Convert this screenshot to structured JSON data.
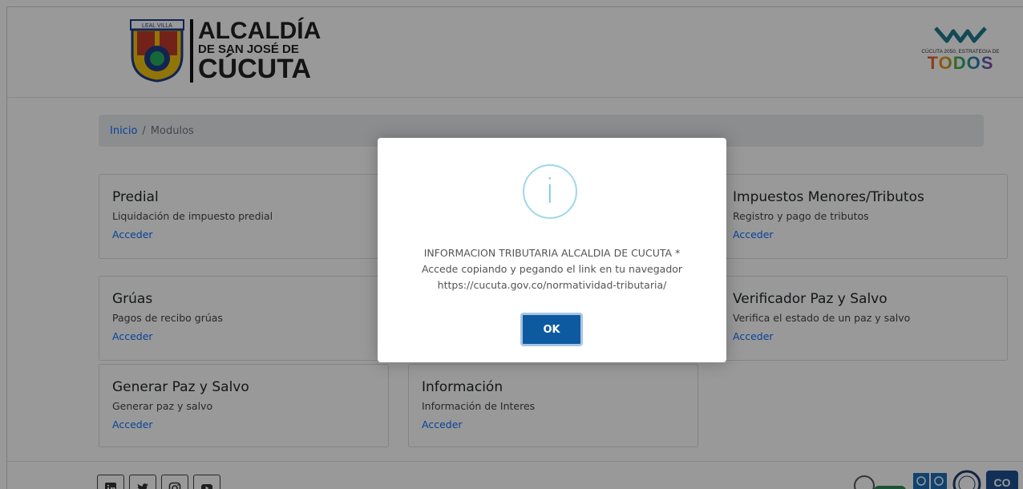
{
  "header": {
    "logo": {
      "line1": "ALCALDÍA",
      "line2": "DE SAN JOSÉ DE",
      "line3": "CÚCUTA"
    },
    "right_logo": {
      "caption": "CÚCUTA 2050, ESTRATEGIA DE",
      "word": "TODOS"
    }
  },
  "breadcrumb": {
    "home": "Inicio",
    "separator": "/",
    "current": "Modulos"
  },
  "modules": [
    {
      "title": "Predial",
      "desc": "Liquidación de impuesto predial",
      "link": "Acceder"
    },
    {
      "title": "Impuestos Menores/Tributos",
      "desc": "Registro y pago de tributos",
      "link": "Acceder"
    },
    {
      "title": "Grúas",
      "desc": "Pagos de recibo grúas",
      "link": "Acceder"
    },
    {
      "title": "Verificador Paz y Salvo",
      "desc": "Verifica el estado de un paz y salvo",
      "link": "Acceder"
    },
    {
      "title": "Generar Paz y Salvo",
      "desc": "Generar paz y salvo",
      "link": "Acceder"
    },
    {
      "title": "Información",
      "desc": "Información de Interes",
      "link": "Acceder"
    }
  ],
  "footer": {
    "social_icons": [
      "linkedin-icon",
      "twitter-icon",
      "instagram-icon",
      "youtube-icon"
    ],
    "badge_text": "CO"
  },
  "modal": {
    "icon": "i",
    "line1": "INFORMACION TRIBUTARIA ALCALDIA DE CUCUTA *",
    "line2": "Accede copiando y pegando el link en tu navegador",
    "line3": "https://cucuta.gov.co/normatividad-tributaria/",
    "ok_label": "OK"
  },
  "colors": {
    "link": "#0d6efd",
    "ok_button": "#0e5aa0",
    "info_icon": "#9fd8ea"
  }
}
